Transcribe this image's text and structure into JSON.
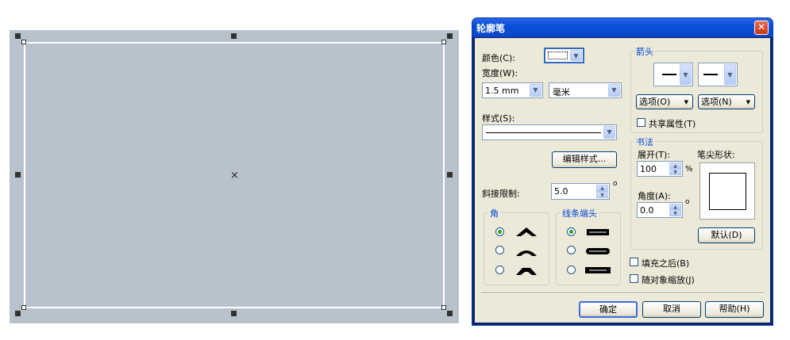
{
  "dialog": {
    "title": "轮廓笔",
    "close_label": "✕",
    "color_label": "颜色(C):",
    "width_label": "宽度(W):",
    "width_value": "1.5 mm",
    "unit_value": "毫米",
    "style_label": "样式(S):",
    "edit_style_button": "编辑样式...",
    "miter_label": "斜接限制:",
    "miter_value": "5.0",
    "degree_symbol": "o",
    "corner_group": "角",
    "cap_group": "线条端头",
    "arrow_group": "箭头",
    "arrow_options_left": "选项(O)",
    "arrow_options_right": "选项(N)",
    "share_attributes": "共享属性(T)",
    "calligraphy_group": "书法",
    "stretch_label": "展开(T):",
    "stretch_value": "100",
    "percent_symbol": "%",
    "nib_shape_label": "笔尖形状:",
    "angle_label": "角度(A):",
    "angle_value": "0.0",
    "default_button": "默认(D)",
    "fill_behind": "填充之后(B)",
    "scale_with_image": "随对象缩放(J)",
    "ok_button": "确定",
    "cancel_button": "取消",
    "help_button": "帮助(H)"
  },
  "icons": {
    "center_marker": "×",
    "dropdown": "▼",
    "spin_up": "▲",
    "spin_down": "▼"
  },
  "colors": {
    "canvas_bg": "#b8c2cc",
    "title_bar": "#0a4fd8",
    "dialog_bg": "#ece9d8",
    "group_title": "#0046d5"
  }
}
